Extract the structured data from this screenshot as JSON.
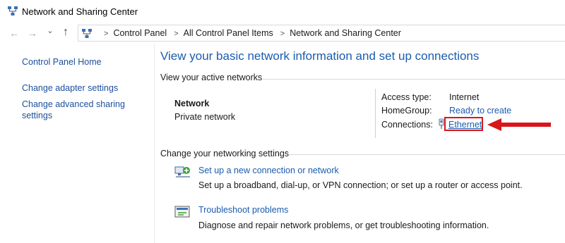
{
  "window": {
    "title": "Network and Sharing Center"
  },
  "nav": {
    "back_icon": "back-arrow-icon",
    "forward_icon": "forward-arrow-icon",
    "recent_icon": "chevron-down-icon",
    "up_icon": "up-arrow-icon"
  },
  "address": {
    "separator": ">",
    "crumbs": [
      "Control Panel",
      "All Control Panel Items",
      "Network and Sharing Center"
    ]
  },
  "sidebar": {
    "items": [
      {
        "label": "Control Panel Home"
      },
      {
        "label": "Change adapter settings"
      },
      {
        "label": "Change advanced sharing"
      },
      {
        "label": "settings"
      }
    ]
  },
  "main": {
    "title": "View your basic network information and set up connections",
    "active_networks": {
      "heading": "View your active networks",
      "network_name": "Network",
      "network_type": "Private network",
      "access_type_label": "Access type:",
      "access_type_value": "Internet",
      "homegroup_label": "HomeGroup:",
      "homegroup_value": "Ready to create",
      "connections_label": "Connections:",
      "connections_value": "Ethernet"
    },
    "change_settings": {
      "heading": "Change your networking settings",
      "tasks": [
        {
          "link": "Set up a new connection or network",
          "description": "Set up a broadband, dial-up, or VPN connection; or set up a router or access point."
        },
        {
          "link": "Troubleshoot problems",
          "description": "Diagnose and repair network problems, or get troubleshooting information."
        }
      ]
    }
  },
  "colors": {
    "link": "#1b5cae",
    "highlight": "#d8161b"
  }
}
